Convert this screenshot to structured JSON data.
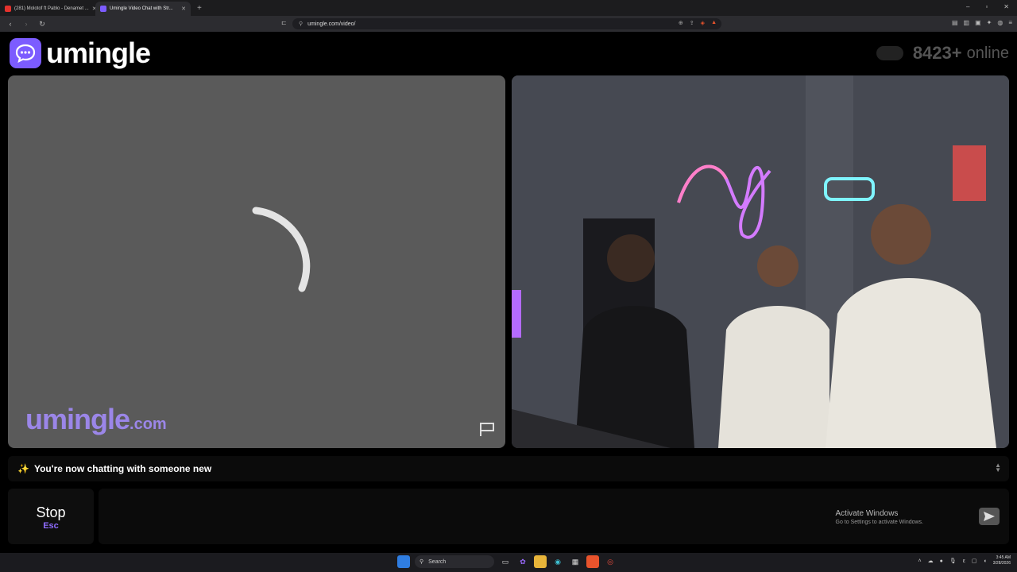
{
  "browser": {
    "tabs": [
      {
        "label": "(281) Molotof ft Pablo - Denamet ...",
        "favicon_color": "#e5322d"
      },
      {
        "label": "Umingle Video Chat with Str...",
        "favicon_color": "#7c5cff"
      }
    ],
    "new_tab": "+",
    "url": "umingle.com/video/"
  },
  "site": {
    "logo_text": "umingle",
    "online_count": "8423+",
    "online_label": "online"
  },
  "video": {
    "watermark_main": "umingle",
    "watermark_suffix": ".com"
  },
  "status": {
    "sparkle": "✨",
    "message": "You're now chatting with someone new"
  },
  "controls": {
    "stop_label": "Stop",
    "stop_key": "Esc"
  },
  "windows_notice": {
    "title": "Activate Windows",
    "subtitle": "Go to Settings to activate Windows."
  },
  "taskbar": {
    "search_label": "Search",
    "time": "3:45 AM",
    "date": "3/28/2026"
  },
  "colors": {
    "brand": "#7c5cff",
    "watermark": "#9b86e8"
  }
}
